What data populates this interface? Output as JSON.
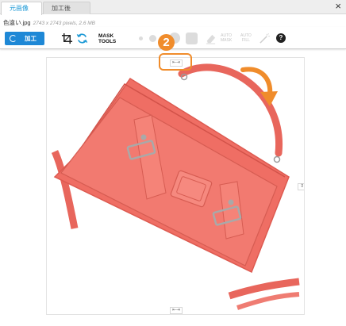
{
  "tabs": [
    {
      "label": "元画像",
      "active": true
    },
    {
      "label": "加工後",
      "active": false
    }
  ],
  "close_label": "×",
  "file": {
    "name": "色違い.jpg",
    "meta": "2743 x 2743 pixels, 2.6 MB"
  },
  "toolbar": {
    "process_label": "加工",
    "mask_tools_line1": "MASK",
    "mask_tools_line2": "TOOLS",
    "auto_mask_line1": "AUTO",
    "auto_mask_line2": "MASK",
    "auto_fill_line1": "AUTO",
    "auto_fill_line2": "FILL",
    "help_label": "?"
  },
  "canvas": {
    "top_handle": "⇤⇥",
    "bottom_handle": "⇤⇥",
    "side_handle": "⇕"
  },
  "callout": {
    "number": "2"
  },
  "colors": {
    "accent": "#1e88d6",
    "callout": "#f08c2b",
    "bag": "#ef6e64"
  }
}
